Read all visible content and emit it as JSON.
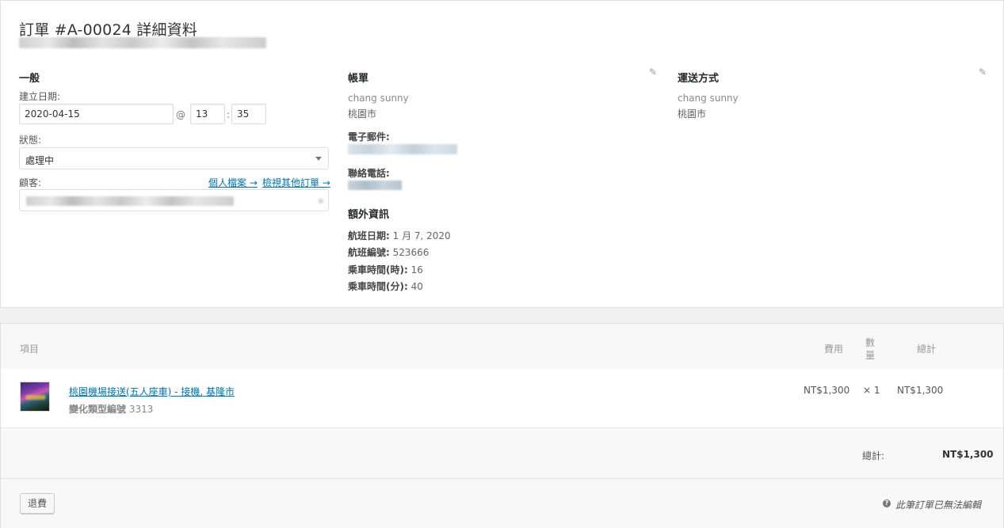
{
  "order": {
    "title": "訂單 #A-00024 詳細資料"
  },
  "general": {
    "heading": "一般",
    "created_label": "建立日期:",
    "date": "2020-04-15",
    "at": "@",
    "hour": "13",
    "colon": ":",
    "minute": "35",
    "status_label": "狀態:",
    "status_value": "處理中",
    "customer_label": "顧客:",
    "profile_link": "個人檔案 →",
    "other_orders_link": "檢視其他訂單 →"
  },
  "billing": {
    "heading": "帳單",
    "name": "chang sunny",
    "city": "桃園市",
    "email_label": "電子郵件:",
    "phone_label": "聯絡電話:",
    "extra_heading": "額外資訊",
    "extra": [
      {
        "label": "航班日期:",
        "value": " 1 月 7, 2020"
      },
      {
        "label": "航班編號:",
        "value": " 523666"
      },
      {
        "label": "乘車時間(時):",
        "value": " 16"
      },
      {
        "label": "乘車時間(分):",
        "value": " 40"
      }
    ]
  },
  "shipping": {
    "heading": "運送方式",
    "name": "chang sunny",
    "city": "桃園市"
  },
  "items": {
    "col_item": "項目",
    "col_cost": "費用",
    "col_qty_1": "數",
    "col_qty_2": "量",
    "col_total": "總計",
    "rows": [
      {
        "name": "桃園機場接送(五人座車) - 接機, 基隆市",
        "meta_label": "變化類型編號",
        "meta_value": " 3313",
        "cost": "NT$1,300",
        "qty": "× 1",
        "total": "NT$1,300"
      }
    ],
    "totals_label": "總計:",
    "totals_value": "NT$1,300",
    "refund_button": "退費",
    "not_editable_note": "此筆訂單已無法編輯"
  }
}
